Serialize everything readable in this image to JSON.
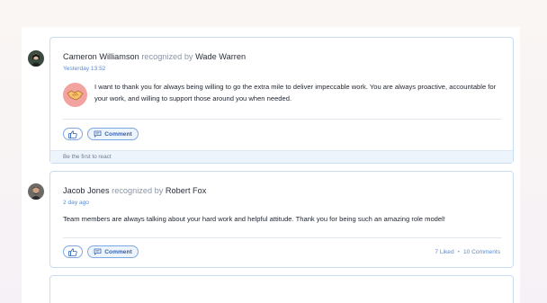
{
  "feed": {
    "posts": [
      {
        "author": "Cameron Williamson",
        "verb": "recognized by",
        "recognizer": "Wade Warren",
        "time": "Yesterday 13:52",
        "message": "I want to thank you for always being willing to go the extra mile to deliver impeccable work. You are always proactive, accountable for your work, and willing to support those around you when needed.",
        "comment_label": "Comment",
        "footer": "Be the first to react",
        "badge_icon": "handshake-icon"
      },
      {
        "author": "Jacob Jones",
        "verb": "recognized by",
        "recognizer": "Robert Fox",
        "time": "2 day ago",
        "message": "Team members are always talking about your hard work and helpful attitude. Thank you for being such an amazing role model!",
        "comment_label": "Comment",
        "likes": "7 Liked",
        "comments": "10 Comments"
      }
    ]
  },
  "colors": {
    "accent": "#2f63b8",
    "card_border": "#c9dcf3",
    "badge_bg": "#f2a3a0"
  }
}
